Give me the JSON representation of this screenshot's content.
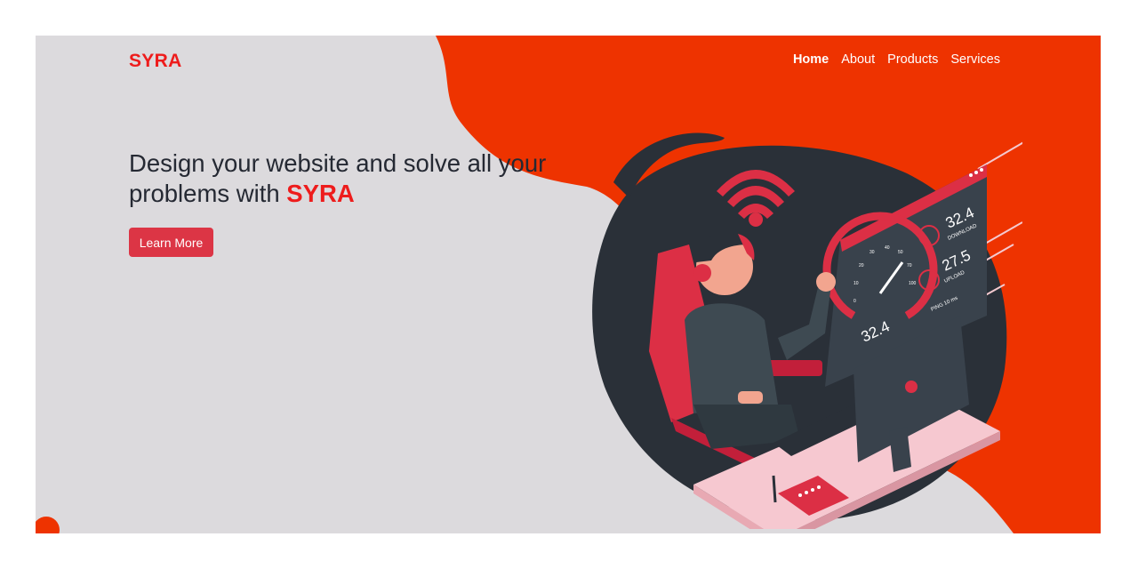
{
  "brand": {
    "logo": "SYRA"
  },
  "nav": {
    "items": [
      {
        "label": "Home",
        "active": true
      },
      {
        "label": "About",
        "active": false
      },
      {
        "label": "Products",
        "active": false
      },
      {
        "label": "Services",
        "active": false
      }
    ]
  },
  "hero": {
    "headline_prefix": "Design your website and solve all your problems with ",
    "headline_accent": "SYRA",
    "cta_label": "Learn More"
  },
  "illustration": {
    "download_value": "32.4",
    "download_label": "DOWNLOAD",
    "upload_value": "27.5",
    "upload_label": "UPLOAD",
    "gauge_value": "32.4",
    "ping_label": "PING 10 ms",
    "gauge_ticks": [
      "0",
      "10",
      "20",
      "30",
      "40",
      "50",
      "70",
      "100"
    ]
  },
  "colors": {
    "accent": "#ee1c1c",
    "blob": "#ee3300",
    "background": "#dcdadd",
    "button": "#dc3545",
    "dark": "#2a3038"
  }
}
